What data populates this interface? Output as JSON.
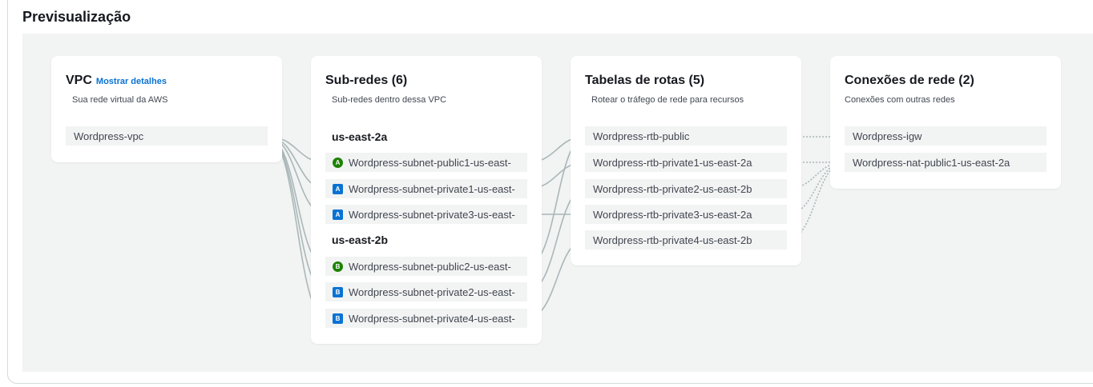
{
  "preview_title": "Previsualização",
  "vpc": {
    "title": "VPC",
    "details_link": "Mostrar detalhes",
    "subtitle": "Sua rede virtual da AWS",
    "item": "Wordpress-vpc"
  },
  "subnets": {
    "title": "Sub-redes (6)",
    "subtitle": "Sub-redes dentro dessa VPC",
    "zone_a": "us-east-2a",
    "zone_b": "us-east-2b",
    "items": [
      {
        "badge": "A",
        "kind": "public",
        "label": "Wordpress-subnet-public1-us-east-"
      },
      {
        "badge": "A",
        "kind": "private",
        "label": "Wordpress-subnet-private1-us-east-"
      },
      {
        "badge": "A",
        "kind": "private",
        "label": "Wordpress-subnet-private3-us-east-"
      },
      {
        "badge": "B",
        "kind": "public",
        "label": "Wordpress-subnet-public2-us-east-"
      },
      {
        "badge": "B",
        "kind": "private",
        "label": "Wordpress-subnet-private2-us-east-"
      },
      {
        "badge": "B",
        "kind": "private",
        "label": "Wordpress-subnet-private4-us-east-"
      }
    ]
  },
  "route_tables": {
    "title": "Tabelas de rotas (5)",
    "subtitle": "Rotear o tráfego de rede para recursos",
    "items": [
      "Wordpress-rtb-public",
      "Wordpress-rtb-private1-us-east-2a",
      "Wordpress-rtb-private2-us-east-2b",
      "Wordpress-rtb-private3-us-east-2a",
      "Wordpress-rtb-private4-us-east-2b"
    ]
  },
  "connections": {
    "title": "Conexões de rede (2)",
    "subtitle": "Conexões com outras redes",
    "items": [
      "Wordpress-igw",
      "Wordpress-nat-public1-us-east-2a"
    ]
  },
  "colors": {
    "public_badge": "#1d8102",
    "private_badge": "#0972d3",
    "link": "#0972d3",
    "connector": "#aab7b8"
  }
}
